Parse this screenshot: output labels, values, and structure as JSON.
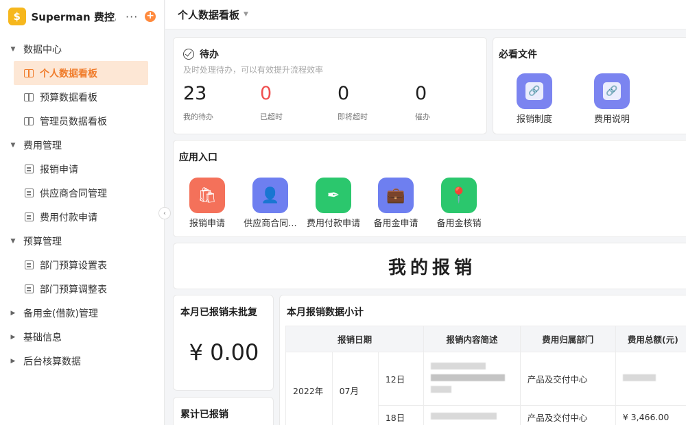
{
  "app": {
    "title": "Superman 费控...",
    "logo_glyph": "$",
    "more": "···",
    "add": "+"
  },
  "sidebar": {
    "groups": [
      {
        "label": "数据中心",
        "expanded": true,
        "items": [
          {
            "label": "个人数据看板",
            "icon": "board-icon",
            "active": true
          },
          {
            "label": "预算数据看板",
            "icon": "board-icon"
          },
          {
            "label": "管理员数据看板",
            "icon": "board-icon"
          }
        ]
      },
      {
        "label": "费用管理",
        "expanded": true,
        "items": [
          {
            "label": "报销申请",
            "icon": "form-icon"
          },
          {
            "label": "供应商合同管理",
            "icon": "form-icon"
          },
          {
            "label": "费用付款申请",
            "icon": "form-icon"
          }
        ]
      },
      {
        "label": "预算管理",
        "expanded": true,
        "items": [
          {
            "label": "部门预算设置表",
            "icon": "form-icon"
          },
          {
            "label": "部门预算调整表",
            "icon": "form-icon"
          }
        ]
      },
      {
        "label": "备用金(借款)管理",
        "expanded": false
      },
      {
        "label": "基础信息",
        "expanded": false
      },
      {
        "label": "后台核算数据",
        "expanded": false
      }
    ]
  },
  "header": {
    "title": "个人数据看板"
  },
  "todo": {
    "title": "待办",
    "subtitle": "及时处理待办，可以有效提升流程效率",
    "stats": [
      {
        "value": "23",
        "label": "我的待办"
      },
      {
        "value": "0",
        "label": "已超时",
        "color": "#f05050"
      },
      {
        "value": "0",
        "label": "即将超时"
      },
      {
        "value": "0",
        "label": "催办"
      }
    ]
  },
  "docs": {
    "title": "必看文件",
    "items": [
      {
        "label": "报销制度",
        "icon": "link-icon",
        "color": "#7b84f0"
      },
      {
        "label": "费用说明",
        "icon": "link-icon",
        "color": "#7b84f0"
      }
    ]
  },
  "apps": {
    "title": "应用入口",
    "items": [
      {
        "label": "报销申请",
        "icon": "shopping-bag-icon",
        "color": "#f4715a"
      },
      {
        "label": "供应商合同...",
        "icon": "person-icon",
        "color": "#6e7ff0"
      },
      {
        "label": "费用付款申请",
        "icon": "pen-icon",
        "color": "#2bc76d"
      },
      {
        "label": "备用金申请",
        "icon": "briefcase-icon",
        "color": "#6e7ff0"
      },
      {
        "label": "备用金核销",
        "icon": "location-pin-icon",
        "color": "#2bc76d"
      }
    ]
  },
  "my_reimbursement": {
    "title": "我的报销"
  },
  "unapproved": {
    "title": "本月已报销未批复",
    "amount": "¥ 0.00"
  },
  "cumulative": {
    "title": "累计已报销"
  },
  "summary": {
    "title": "本月报销数据小计",
    "columns": [
      "报销日期",
      "报销内容简述",
      "费用归属部门",
      "费用总额(元)"
    ],
    "year": "2022年",
    "month": "07月",
    "rows": [
      {
        "day": "12日",
        "dept": "产品及交付中心",
        "amount": ""
      },
      {
        "day": "18日",
        "dept": "产品及交付中心",
        "amount": "¥ 3,466.00"
      }
    ]
  }
}
